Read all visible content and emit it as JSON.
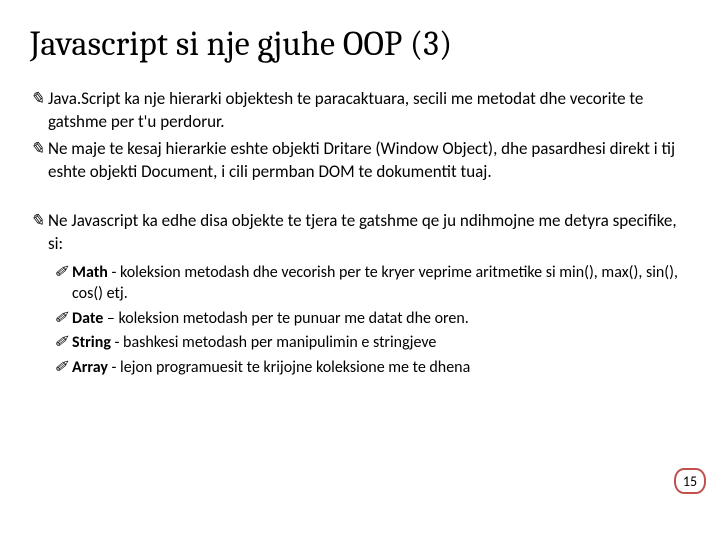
{
  "title": "Javascript si nje gjuhe OOP (3)",
  "bullets": [
    {
      "text": "Java.Script ka nje hierarki objektesh te paracaktuara, secili me metodat dhe vecorite te gatshme per t'u perdorur."
    },
    {
      "text": "Ne maje te kesaj hierarkie eshte objekti Dritare (Window Object), dhe pasardhesi direkt i tij eshte objekti Document, i cili permban DOM te dokumentit tuaj."
    }
  ],
  "bullets2": [
    {
      "text": "Ne Javascript ka edhe disa objekte te tjera te gatshme qe ju ndihmojne me detyra specifike, si:"
    }
  ],
  "subs": [
    {
      "bold": "Math",
      "rest": " - koleksion metodash dhe vecorish per te kryer veprime aritmetike si min(), max(), sin(), cos() etj."
    },
    {
      "bold": "Date",
      "rest": " – koleksion metodash per te punuar me datat dhe oren."
    },
    {
      "bold": "String",
      "rest": " - bashkesi metodash per manipulimin e stringjeve"
    },
    {
      "bold": "Array",
      "rest": " - lejon programuesit te krijojne koleksione me te dhena"
    }
  ],
  "page": "15"
}
